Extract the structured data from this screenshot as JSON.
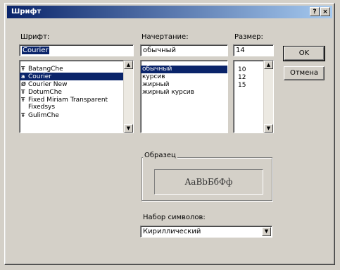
{
  "window": {
    "title": "Шрифт",
    "help_glyph": "?",
    "close_glyph": "×"
  },
  "font": {
    "label": "Шрифт:",
    "value": "Courier",
    "items": [
      {
        "icon": "tt",
        "label": "BatangChe"
      },
      {
        "icon": "a",
        "label": "Courier"
      },
      {
        "icon": "o",
        "label": "Courier New"
      },
      {
        "icon": "tt",
        "label": "DotumChe"
      },
      {
        "icon": "tt",
        "label": "Fixed Miriam Transparent"
      },
      {
        "icon": "",
        "label": "Fixedsys"
      },
      {
        "icon": "tt",
        "label": "GulimChe"
      }
    ],
    "selected_index": 1
  },
  "style": {
    "label": "Начертание:",
    "value": "обычный",
    "items": [
      "обычный",
      "курсив",
      "жирный",
      "жирный курсив"
    ],
    "selected_index": 0
  },
  "size": {
    "label": "Размер:",
    "value": "14",
    "items": [
      "10",
      "12",
      "15"
    ]
  },
  "buttons": {
    "ok": "OK",
    "cancel": "Отмена"
  },
  "sample": {
    "label": "Образец",
    "text": "AaBbБбФф"
  },
  "charset": {
    "label": "Набор символов:",
    "value": "Кириллический"
  },
  "icons": {
    "tt": "Ŧ",
    "a": "a",
    "o": "Ø",
    "scroll_up": "▲",
    "scroll_down": "▼"
  }
}
